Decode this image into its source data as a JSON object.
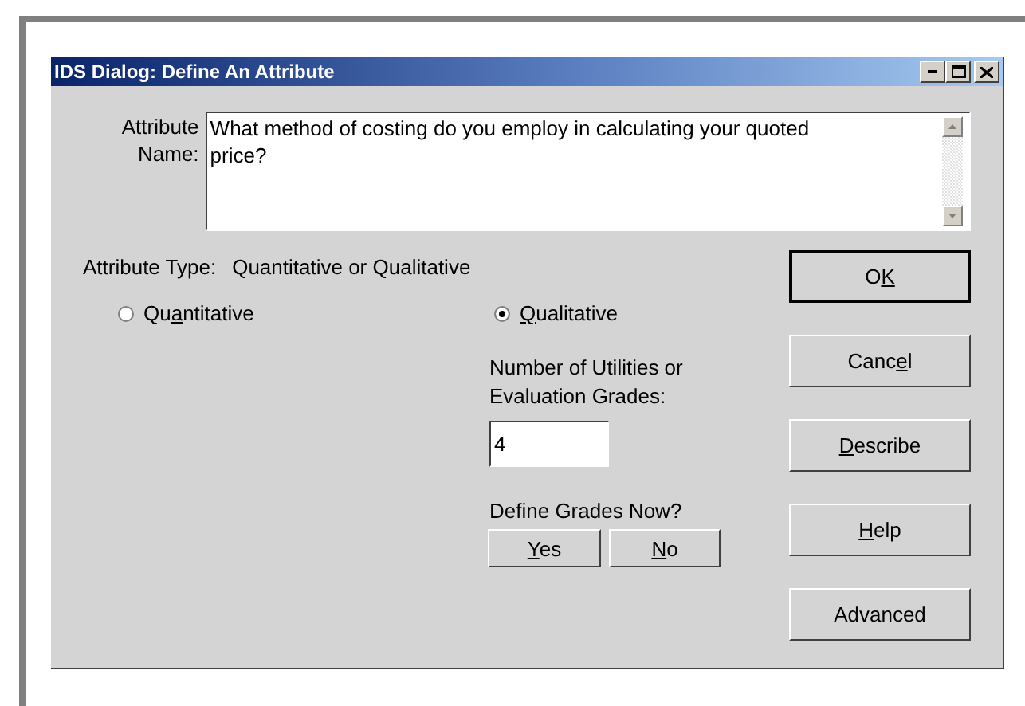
{
  "window": {
    "title": "IDS Dialog: Define An Attribute"
  },
  "attribute_name": {
    "label_lines": [
      "Attribute",
      "Name:"
    ],
    "value": "What method of costing do you employ in calculating your quoted price?"
  },
  "attribute_type": {
    "label": "Attribute Type:",
    "value": "Quantitative or Qualitative"
  },
  "types": [
    {
      "label_parts": [
        {
          "text": "Qu",
          "underlined": false
        },
        {
          "text": "a",
          "underlined": true
        },
        {
          "text": "ntitative",
          "underlined": false
        }
      ],
      "selected": false
    },
    {
      "label_parts": [
        {
          "text": "Q",
          "underlined": true
        },
        {
          "text": "ualitative",
          "underlined": false
        }
      ],
      "selected": true
    }
  ],
  "grades": {
    "label": "Number of  Utilities or Evaluation Grades:",
    "value": "4"
  },
  "define_now": {
    "label": "Define Grades Now?",
    "buttons": [
      {
        "label_parts": [
          {
            "text": "Y",
            "underlined": true
          },
          {
            "text": "es",
            "underlined": false
          }
        ]
      },
      {
        "label_parts": [
          {
            "text": "N",
            "underlined": true
          },
          {
            "text": "o",
            "underlined": false
          }
        ]
      }
    ]
  },
  "buttons": [
    {
      "label_parts": [
        {
          "text": "O",
          "underlined": false
        },
        {
          "text": "K",
          "underlined": true
        }
      ],
      "default": true
    },
    {
      "label_parts": [
        {
          "text": "Canc",
          "underlined": false
        },
        {
          "text": "e",
          "underlined": true
        },
        {
          "text": "l",
          "underlined": false
        }
      ],
      "default": false
    },
    {
      "label_parts": [
        {
          "text": "D",
          "underlined": true
        },
        {
          "text": "escribe",
          "underlined": false
        }
      ],
      "default": false
    },
    {
      "label_parts": [
        {
          "text": "H",
          "underlined": true
        },
        {
          "text": "elp",
          "underlined": false
        }
      ],
      "default": false
    },
    {
      "label_parts": [
        {
          "text": "Advanced",
          "underlined": false
        }
      ],
      "default": false
    }
  ]
}
